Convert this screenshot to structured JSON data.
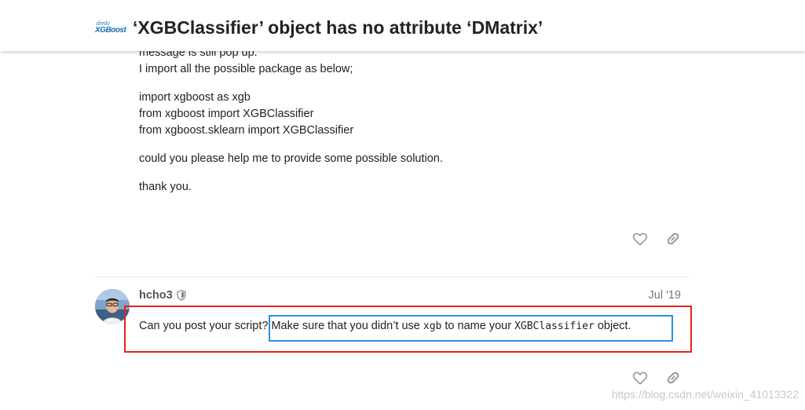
{
  "header": {
    "logo_small": "dmlc",
    "logo_text": "XGBoost",
    "title": "‘XGBClassifier’ object has no attribute ‘DMatrix’"
  },
  "first_post": {
    "paragraphs": [
      [
        "message is still pop up.",
        "I import all the possible package as below;"
      ],
      [
        "import xgboost as xgb",
        "from xgboost import XGBClassifier",
        "from xgboost.sklearn import XGBClassifier"
      ],
      [
        "could you please help me to provide some possible solution."
      ],
      [
        "thank you."
      ]
    ]
  },
  "reply": {
    "username": "hcho3",
    "date": "Jul '19",
    "text_before": "Can you post your script? Make sure that you didn’t use ",
    "code1": "xgb",
    "text_middle": " to name your ",
    "code2": "XGBClassifier",
    "text_after": " object."
  },
  "icons": {
    "like": "heart-icon",
    "link": "link-icon",
    "moderator": "shield-icon"
  },
  "annotation_colors": {
    "red": "#e0251e",
    "blue": "#2b8fe0"
  },
  "watermark": "https://blog.csdn.net/weixin_41013322"
}
